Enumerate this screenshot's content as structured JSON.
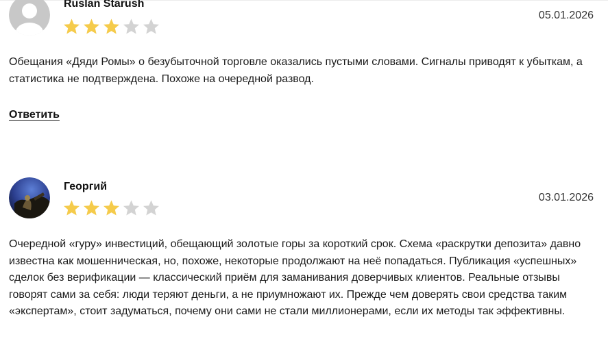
{
  "reviews": [
    {
      "author": "Ruslan Starush",
      "date": "05.01.2026",
      "rating": 3,
      "rating_max": 5,
      "avatar": "default-user-avatar",
      "text": "Обещания «Дяди Ромы» о безубыточной торговле оказались пустыми словами. Сигналы приводят к убыткам, а статистика не подтверждена. Похоже на очередной развод.",
      "reply_label": "Ответить"
    },
    {
      "author": "Георгий",
      "date": "03.01.2026",
      "rating": 3,
      "rating_max": 5,
      "avatar": "photo-avatar",
      "text": "Очередной «гуру» инвестиций, обещающий золотые горы за короткий срок. Схема «раскрутки депозита» давно известна как мошенническая, но, похоже, некоторые продолжают на неё попадаться. Публикация «успешных» сделок без верификации — классический приём для заманивания доверчивых клиентов. Реальные отзывы говорят сами за себя: люди теряют деньги, а не приумножают их. Прежде чем доверять свои средства таким «экспертам», стоит задуматься, почему они сами не стали миллионерами, если их методы так эффективны."
    }
  ],
  "colors": {
    "star_filled": "#f5cb4b",
    "star_empty": "#d3d3d3"
  }
}
